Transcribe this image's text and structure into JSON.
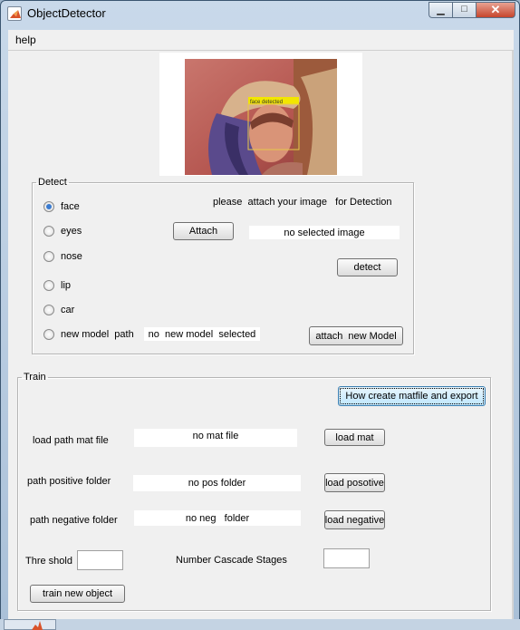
{
  "window": {
    "title": "ObjectDetector"
  },
  "menu": {
    "help": "help"
  },
  "icons": {
    "app": "matlab-icon",
    "minimize": "minimize-icon",
    "maximize": "maximize-icon",
    "close": "close-icon"
  },
  "detect": {
    "legend": "Detect",
    "options": [
      {
        "label": "face",
        "selected": true
      },
      {
        "label": "eyes",
        "selected": false
      },
      {
        "label": "nose",
        "selected": false
      },
      {
        "label": "lip",
        "selected": false
      },
      {
        "label": "car",
        "selected": false
      },
      {
        "label": "new model  path",
        "selected": false
      }
    ],
    "instruction": "please  attach your image   for Detection",
    "attach_button": "Attach",
    "image_status": "no selected image",
    "detect_button": "detect",
    "model_status": "no  new model  selected",
    "attach_model_button": "attach  new Model"
  },
  "preview": {
    "box_label": "face detected"
  },
  "train": {
    "legend": "Train",
    "help_button": "How create matfile and export",
    "mat_label": "load path mat file",
    "mat_status": "no mat file",
    "mat_button": "load mat",
    "pos_label": "path positive folder",
    "pos_status": "no pos folder",
    "pos_button": "load posotive",
    "neg_label": "path negative folder",
    "neg_status": "no neg   folder",
    "neg_button": "load negative",
    "threshold_label": "Thre shold",
    "threshold_value": "",
    "stages_label": "Number Cascade Stages",
    "stages_value": "",
    "train_button": "train new object"
  },
  "colors": {
    "selected_radio": "#3a7bd0",
    "client_bg": "#f0f0f0",
    "detection_box": "#f2e600"
  }
}
